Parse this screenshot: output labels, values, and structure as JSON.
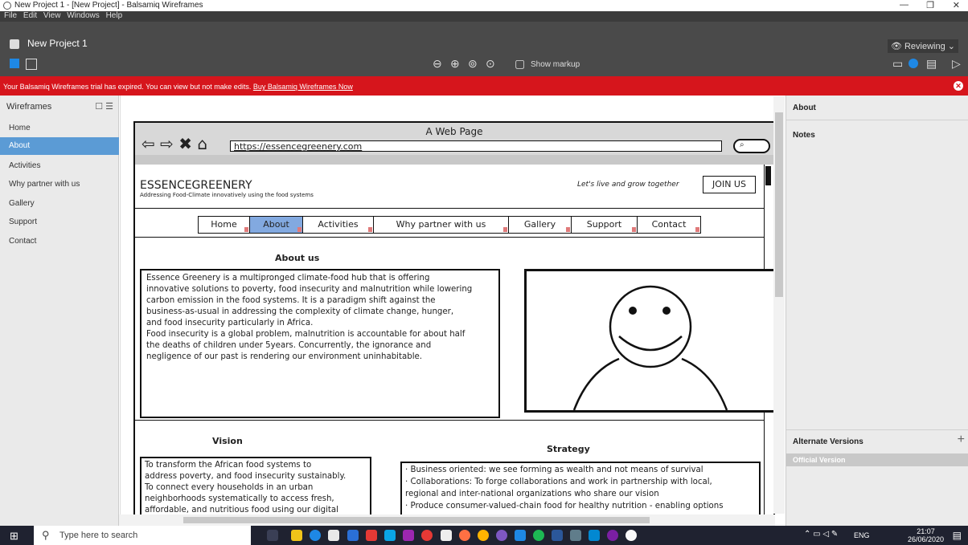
{
  "window": {
    "title": "New Project 1 - [New Project] - Balsamiq Wireframes"
  },
  "menu": [
    "File",
    "Edit",
    "View",
    "Windows",
    "Help"
  ],
  "project": {
    "title": "New Project 1",
    "mode": "Reviewing",
    "show_markup": "Show markup"
  },
  "banner": {
    "message": "Your Balsamiq Wireframes trial has expired. You can view but not make edits.",
    "link": "Buy Balsamiq Wireframes Now",
    "color": "#d6151c"
  },
  "sidebar": {
    "title": "Wireframes",
    "items": [
      {
        "label": "Home"
      },
      {
        "label": "About",
        "selected": true
      },
      {
        "label": "Activities"
      },
      {
        "label": "Why partner with us"
      },
      {
        "label": "Gallery"
      },
      {
        "label": "Support"
      },
      {
        "label": "Contact"
      }
    ]
  },
  "right_panel": {
    "title": "About",
    "notes": "Notes",
    "alternate_versions": "Alternate Versions",
    "official_version": "Official Version"
  },
  "wireframe": {
    "browser_title": "A Web Page",
    "url": "https://essencegreenery.com",
    "brand": "ESSENCEGREENERY",
    "tagline_sub": "Addressing Food-Climate innovatively using the food systems",
    "slogan": "Let's live and grow together",
    "join": "JOIN US",
    "nav": [
      "Home",
      "About",
      "Activities",
      "Why partner with us",
      "Gallery",
      "Support",
      "Contact"
    ],
    "about_heading": "About us",
    "about_lines": [
      "Essence Greenery is a multipronged climate-food hub that is offering",
      "innovative solutions to poverty, food insecurity and malnutrition while lowering",
      "carbon emission in the food systems. It is a paradigm shift against the",
      "business-as-usual in addressing the complexity of climate change, hunger,",
      "and food insecurity particularly in Africa.",
      "Food insecurity is a global problem, malnutrition is accountable for about half",
      "the deaths of children under 5years. Concurrently, the ignorance and",
      "negligence of our past is rendering our environment uninhabitable."
    ],
    "vision_heading": "Vision",
    "vision_lines": [
      "To transform the African food systems to",
      "address poverty, and food insecurity sustainably.",
      "To connect every households in an urban",
      "neighborhoods systematically to access fresh,",
      "affordable, and nutritious food using our digital"
    ],
    "strategy_heading": "Strategy",
    "strategy_lines": [
      "· Business oriented: we see forming as wealth and not means of survival",
      "· Collaborations: To forge collaborations and work in partnership with local,",
      "regional and inter-national organizations who share our vision",
      "· Produce consumer-valued-chain food for healthy nutrition - enabling options"
    ]
  },
  "taskbar": {
    "search_placeholder": "Type here to search",
    "lang": "ENG",
    "time": "21:07",
    "date": "26/06/2020"
  }
}
